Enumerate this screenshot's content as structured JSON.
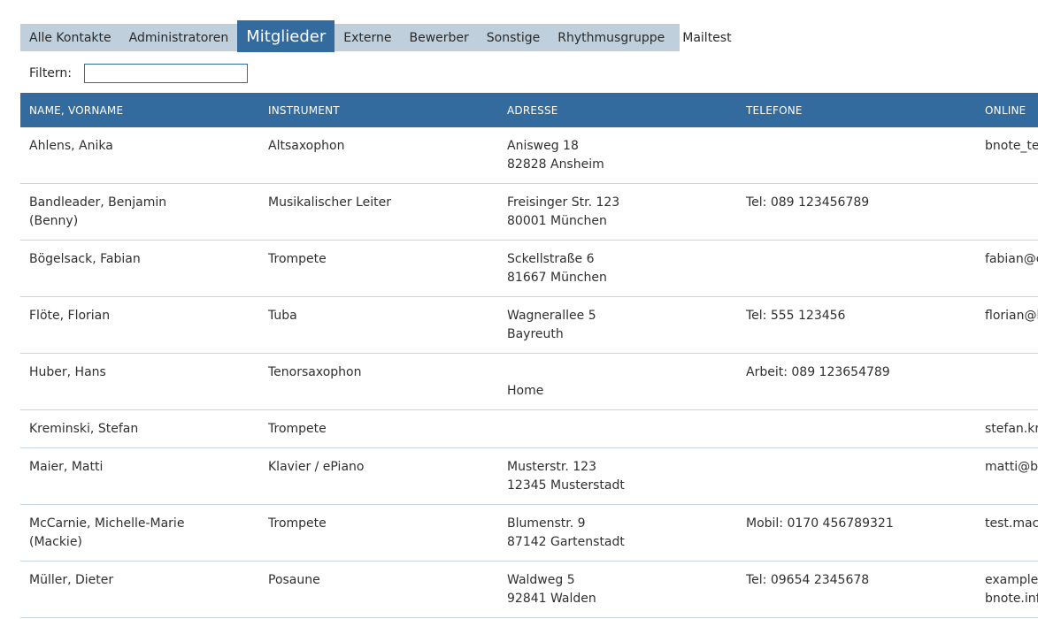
{
  "tabs": [
    {
      "label": "Alle Kontakte"
    },
    {
      "label": "Administratoren"
    },
    {
      "label": "Mitglieder",
      "active": true
    },
    {
      "label": "Externe"
    },
    {
      "label": "Bewerber"
    },
    {
      "label": "Sonstige"
    },
    {
      "label": "Rhythmusgruppe"
    },
    {
      "label": "Mailtest"
    }
  ],
  "filter": {
    "label": "Filtern:",
    "value": ""
  },
  "table": {
    "headers": [
      "NAME, VORNAME",
      "INSTRUMENT",
      "ADRESSE",
      "TELEFONE",
      "ONLINE"
    ],
    "rows": [
      {
        "name": [
          "Ahlens, Anika"
        ],
        "instrument": "Altsaxophon",
        "address": [
          "Anisweg 18",
          "82828 Ansheim"
        ],
        "phone": [
          ""
        ],
        "online": [
          "bnote_tes"
        ]
      },
      {
        "name": [
          "Bandleader, Benjamin",
          "(Benny)"
        ],
        "instrument": "Musikalischer Leiter",
        "address": [
          "Freisinger Str. 123",
          "80001 München"
        ],
        "phone": [
          "Tel: 089 123456789"
        ],
        "online": [
          ""
        ]
      },
      {
        "name": [
          "Bögelsack, Fabian"
        ],
        "instrument": "Trompete",
        "address": [
          "Sckellstraße 6",
          "81667 München"
        ],
        "phone": [
          ""
        ],
        "online": [
          "fabian@c"
        ]
      },
      {
        "name": [
          "Flöte, Florian"
        ],
        "instrument": "Tuba",
        "address": [
          "Wagnerallee 5",
          "Bayreuth"
        ],
        "phone": [
          "Tel: 555 123456"
        ],
        "online": [
          "florian@b"
        ]
      },
      {
        "name": [
          "Huber, Hans"
        ],
        "instrument": "Tenorsaxophon",
        "address": [
          "",
          "Home"
        ],
        "phone": [
          "Arbeit: 089 123654789"
        ],
        "online": [
          ""
        ]
      },
      {
        "name": [
          "Kreminski, Stefan"
        ],
        "instrument": "Trompete",
        "address": [
          ""
        ],
        "phone": [
          ""
        ],
        "online": [
          "stefan.kre"
        ]
      },
      {
        "name": [
          "Maier, Matti"
        ],
        "instrument": "Klavier / ePiano",
        "address": [
          "Musterstr. 123",
          "12345 Musterstadt"
        ],
        "phone": [
          ""
        ],
        "online": [
          "matti@br"
        ]
      },
      {
        "name": [
          "McCarnie, Michelle-Marie",
          "(Mackie)"
        ],
        "instrument": "Trompete",
        "address": [
          "Blumenstr. 9",
          "87142 Gartenstadt"
        ],
        "phone": [
          "Mobil: 0170 456789321"
        ],
        "online": [
          "test.mack"
        ]
      },
      {
        "name": [
          "Müller, Dieter"
        ],
        "instrument": "Posaune",
        "address": [
          "Waldweg 5",
          "92841 Walden"
        ],
        "phone": [
          "Tel: 09654 2345678"
        ],
        "online": [
          "example@",
          "bnote.info"
        ]
      }
    ]
  }
}
